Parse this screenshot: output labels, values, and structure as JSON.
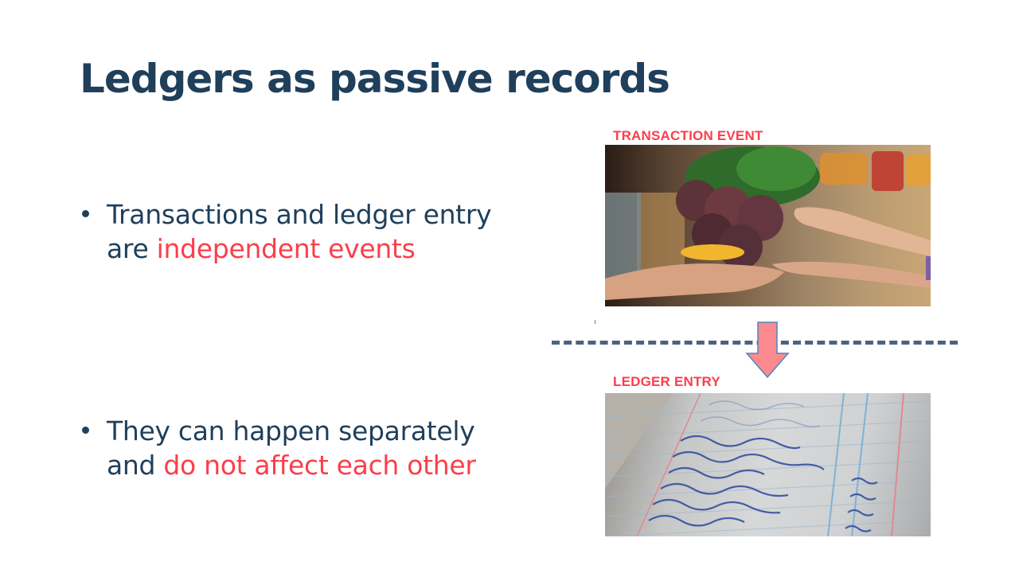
{
  "slide": {
    "title": "Ledgers as passive records",
    "bullets": [
      {
        "line1": "Transactions and ledger entry",
        "line2_prefix": "are ",
        "line2_highlight": "independent events"
      },
      {
        "line1": "They can happen separately",
        "line2_prefix": "and ",
        "line2_highlight": "do not affect each other"
      }
    ],
    "images": [
      {
        "label": "TRANSACTION EVENT",
        "icon": "photo-hands-exchanging-beets"
      },
      {
        "label": "LEDGER ENTRY",
        "icon": "photo-handwritten-ledger"
      }
    ],
    "connector": {
      "icon": "down-arrow-icon",
      "divider": "dashed-line"
    },
    "colors": {
      "title": "#1f3f5b",
      "body": "#1f3f5b",
      "highlight": "#fb3e4b",
      "arrow_fill": "#fd8a8e",
      "arrow_stroke": "#4a86c5",
      "divider": "#4a6384"
    }
  }
}
